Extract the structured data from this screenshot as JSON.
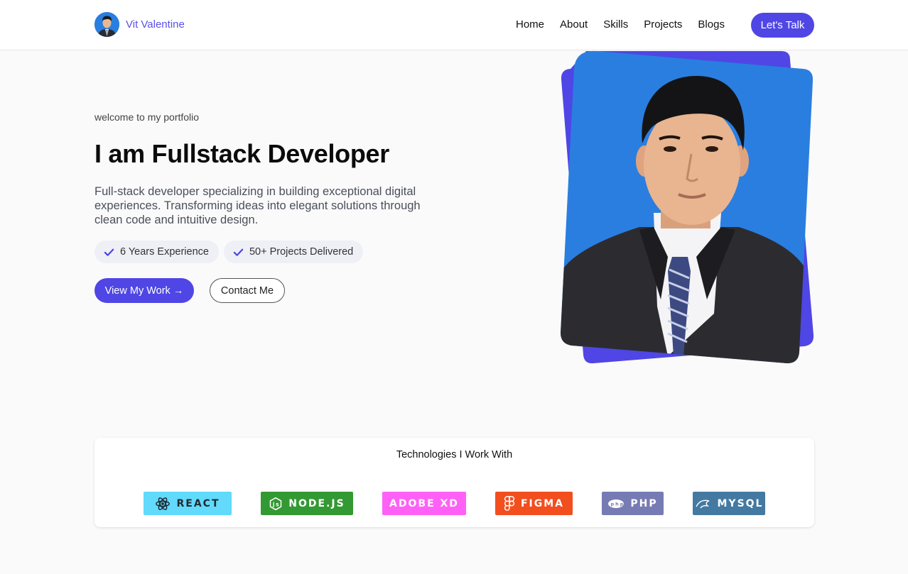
{
  "header": {
    "brand_name": "Vit Valentine",
    "nav": [
      "Home",
      "About",
      "Skills",
      "Projects",
      "Blogs"
    ],
    "cta_label": "Let's Talk"
  },
  "hero": {
    "welcome": "welcome to my portfolio",
    "headline": "I am Fullstack Developer",
    "description": "Full-stack developer specializing in building exceptional digital experiences. Transforming ideas into elegant solutions through clean code and intuitive design.",
    "chips": [
      "6 Years Experience",
      "50+ Projects Delivered"
    ],
    "primary_button": "View My Work →",
    "secondary_button": "Contact Me"
  },
  "technologies": {
    "title": "Technologies I Work With",
    "badges": [
      {
        "label": "REACT",
        "icon": "react-icon",
        "color": "#61dafb"
      },
      {
        "label": "NODE.JS",
        "icon": "nodejs-icon",
        "color": "#339933"
      },
      {
        "label": "ADOBE XD",
        "icon": "",
        "color": "#ff61f6"
      },
      {
        "label": "FIGMA",
        "icon": "figma-icon",
        "color": "#f24e1e"
      },
      {
        "label": "PHP",
        "icon": "php-icon",
        "color": "#777bb4"
      },
      {
        "label": "MYSQL",
        "icon": "mysql-icon",
        "color": "#4479a1"
      }
    ]
  },
  "colors": {
    "accent": "#4f46e5",
    "portrait_background": "#2a7ee0"
  }
}
